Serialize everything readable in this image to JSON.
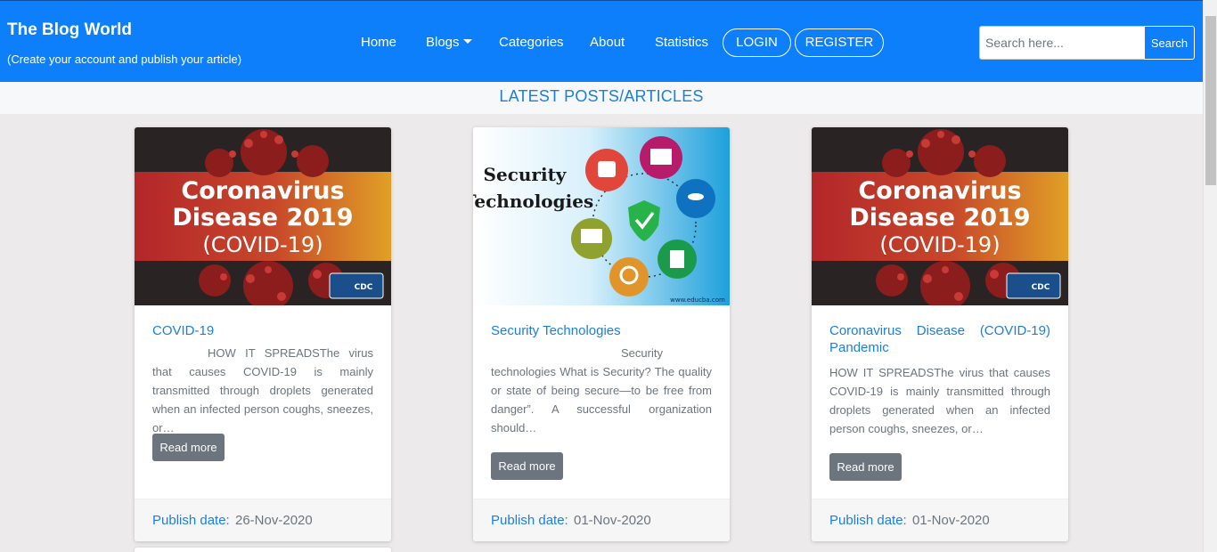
{
  "brand": {
    "title": "The Blog World",
    "subtitle": "(Create your account and publish your article)"
  },
  "nav": {
    "home": "Home",
    "blogs": "Blogs",
    "categories": "Categories",
    "about": "About",
    "statistics": "Statistics",
    "login": "LOGIN",
    "register": "REGISTER"
  },
  "search": {
    "placeholder": "Search here...",
    "value": "",
    "button": "Search"
  },
  "heading": "LATEST POSTS/ARTICLES",
  "colors": {
    "navbar": "#0d7ffb",
    "accent": "#1a7fdf",
    "button": "#6c757d"
  },
  "cards": [
    {
      "image_text": [
        "Coronavirus",
        "Disease 2019",
        "(COVID-19)"
      ],
      "image_badge": "CDC",
      "title": "COVID-19",
      "excerpt": "HOW IT SPREADSThe virus that causes COVID-19 is mainly transmitted through droplets generated when an infected person coughs, sneezes, or…",
      "read_more": "Read more",
      "publish_label": "Publish date:",
      "publish_date": "26-Nov-2020"
    },
    {
      "image_text": [
        "Security",
        "Technologies"
      ],
      "image_watermark": "www.educba.com",
      "title": "Security Technologies",
      "excerpt": "Security technologies What is Security? The quality or state of being secure—to be free from danger”. A successful organization should…",
      "read_more": "Read more",
      "publish_label": "Publish date:",
      "publish_date": "01-Nov-2020"
    },
    {
      "image_text": [
        "Coronavirus",
        "Disease 2019",
        "(COVID-19)"
      ],
      "image_badge": "CDC",
      "title": "Coronavirus Disease (COVID-19) Pandemic",
      "excerpt": "HOW IT SPREADSThe virus that causes COVID-19 is mainly transmitted through droplets generated when an infected person coughs, sneezes, or…",
      "read_more": "Read more",
      "publish_label": "Publish date:",
      "publish_date": "01-Nov-2020"
    }
  ]
}
